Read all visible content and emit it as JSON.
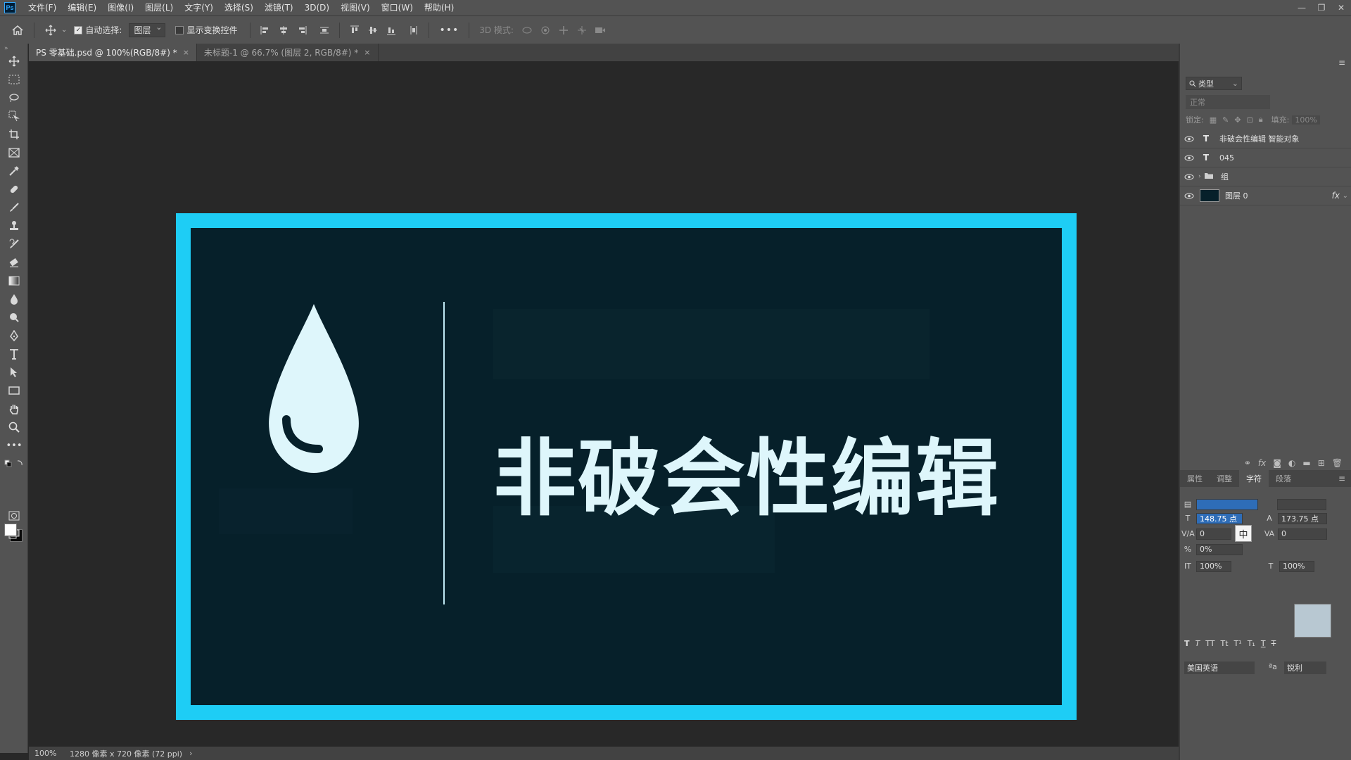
{
  "app": {
    "logo": "Ps",
    "menu": [
      "文件(F)",
      "编辑(E)",
      "图像(I)",
      "图层(L)",
      "文字(Y)",
      "选择(S)",
      "滤镜(T)",
      "3D(D)",
      "视图(V)",
      "窗口(W)",
      "帮助(H)"
    ]
  },
  "options": {
    "auto_select_label": "自动选择:",
    "auto_select_value": "图层",
    "show_transform_label": "显示变换控件",
    "more": "•••",
    "mode3d_label": "3D 模式:"
  },
  "tabs": [
    {
      "label": "PS 零基础.psd @ 100%(RGB/8#) *",
      "close": "×"
    },
    {
      "label": "未标题-1 @ 66.7% (图层 2, RGB/8#) *",
      "close": "×"
    }
  ],
  "artwork": {
    "headline": "非破会性编辑",
    "colors": {
      "frame": "#1ecdf5",
      "background": "#06202a",
      "text": "#def6fb"
    }
  },
  "status": {
    "zoom": "100%",
    "info": "1280 像素 x 720 像素 (72 ppi)",
    "arrow": "›"
  },
  "layers_panel": {
    "filter": "类型",
    "blend_mode": "正常",
    "lock_label": "锁定:",
    "fill_label": "填充:",
    "fill_value": "100%",
    "layers": [
      {
        "type": "T",
        "name": "非破会性编辑 智能对象"
      },
      {
        "type": "T",
        "name": "045"
      },
      {
        "type": "folder",
        "name": "组"
      },
      {
        "type": "image",
        "name": "图层 0",
        "fx": "fx"
      }
    ]
  },
  "char_panel": {
    "tabs": [
      "属性",
      "调整",
      "字符",
      "段落"
    ],
    "font_size": "148.75 点",
    "leading": "173.75 点",
    "kerning": "0",
    "tracking": "0",
    "scale_tsume": "0%",
    "vertical_scale": "100%",
    "horizontal_scale": "100%",
    "language": "美国英语",
    "aa_label": "ªa",
    "antialias": "锐利"
  }
}
